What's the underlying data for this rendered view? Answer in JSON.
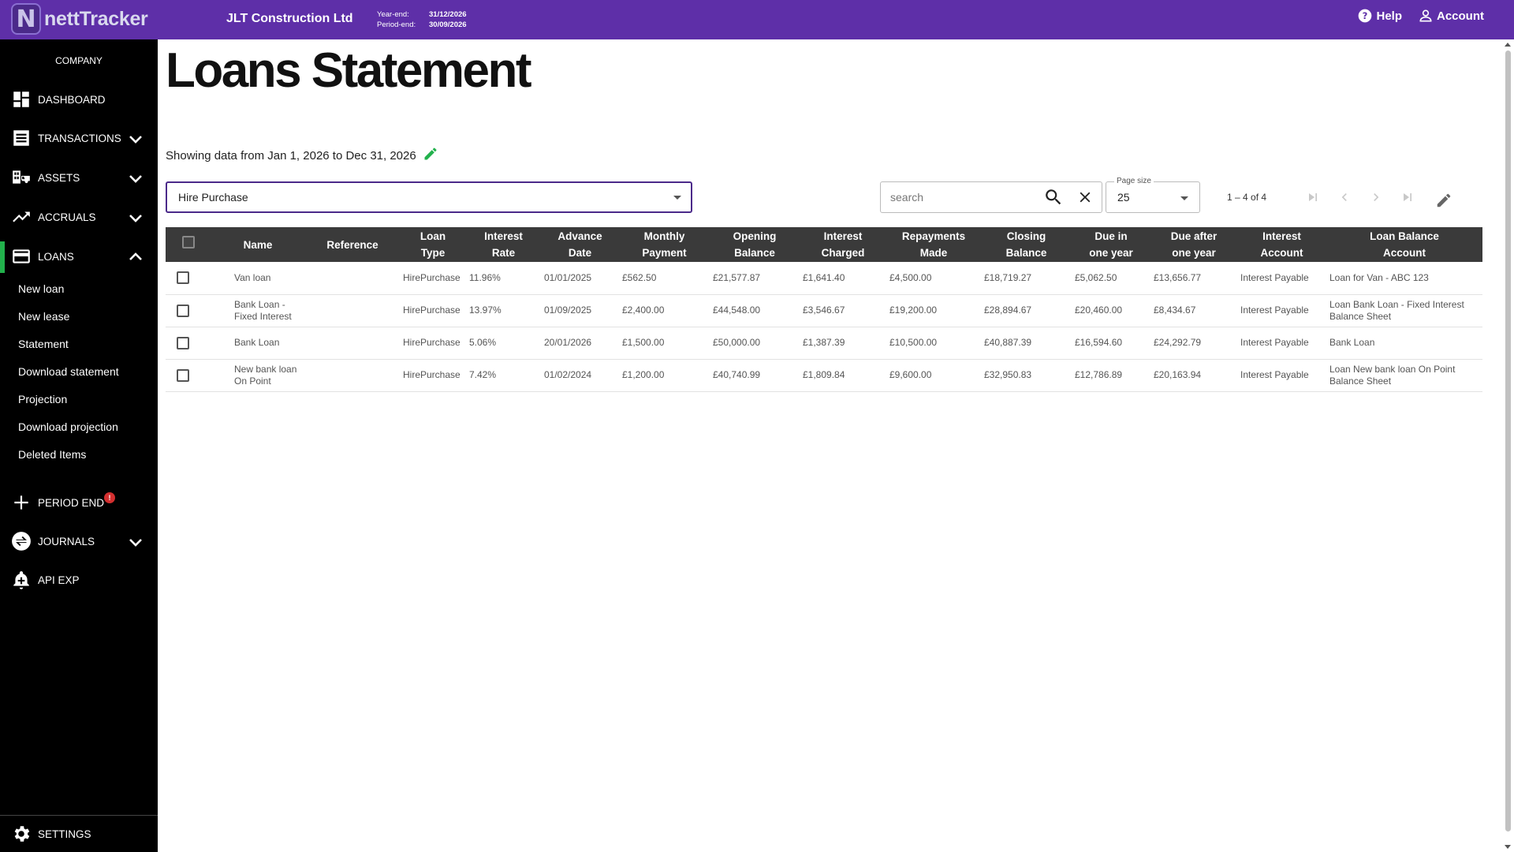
{
  "brand": {
    "logo_letter": "N",
    "name": "nettTracker"
  },
  "header": {
    "company": "JLT Construction Ltd",
    "year_end_label": "Year-end:",
    "year_end_value": "31/12/2026",
    "period_end_label": "Period-end:",
    "period_end_value": "30/09/2026",
    "help_label": "Help",
    "account_label": "Account"
  },
  "sidebar": {
    "company_label": "COMPANY",
    "items": [
      {
        "label": "DASHBOARD",
        "icon": "dashboard-icon"
      },
      {
        "label": "TRANSACTIONS",
        "icon": "list-icon"
      },
      {
        "label": "ASSETS",
        "icon": "assets-icon"
      },
      {
        "label": "ACCRUALS",
        "icon": "trending-up-icon"
      },
      {
        "label": "LOANS",
        "icon": "card-icon"
      },
      {
        "label": "PERIOD END",
        "icon": "plus-icon"
      },
      {
        "label": "JOURNALS",
        "icon": "swap-icon"
      },
      {
        "label": "API EXP",
        "icon": "notification-add-icon"
      }
    ],
    "loans_sub": [
      "New loan",
      "New lease",
      "Statement",
      "Download statement",
      "Projection",
      "Download projection",
      "Deleted Items"
    ],
    "period_end_badge": "!",
    "settings_label": "SETTINGS"
  },
  "main": {
    "title": "Loans Statement",
    "date_range": "Showing data from Jan 1, 2026 to Dec 31, 2026",
    "loan_type_selected": "Hire Purchase",
    "search_placeholder": "search",
    "page_size_label": "Page size",
    "page_size_value": "25",
    "range_label": "1 – 4 of 4"
  },
  "table": {
    "columns": [
      "",
      "Name",
      "Reference",
      "Loan\nType",
      "Interest\nRate",
      "Advance\nDate",
      "Monthly\nPayment",
      "Opening\nBalance",
      "Interest\nCharged",
      "Repayments\nMade",
      "Closing\nBalance",
      "Due in\none year",
      "Due after\none year",
      "Interest\nAccount",
      "Loan Balance\nAccount"
    ],
    "rows": [
      [
        "Van loan",
        "",
        "HirePurchase",
        "11.96%",
        "01/01/2025",
        "£562.50",
        "£21,577.87",
        "£1,641.40",
        "£4,500.00",
        "£18,719.27",
        "£5,062.50",
        "£13,656.77",
        "Interest Payable",
        "Loan for Van - ABC 123"
      ],
      [
        "Bank Loan - Fixed Interest",
        "",
        "HirePurchase",
        "13.97%",
        "01/09/2025",
        "£2,400.00",
        "£44,548.00",
        "£3,546.67",
        "£19,200.00",
        "£28,894.67",
        "£20,460.00",
        "£8,434.67",
        "Interest Payable",
        "Loan Bank Loan - Fixed Interest Balance Sheet"
      ],
      [
        "Bank Loan",
        "",
        "HirePurchase",
        "5.06%",
        "20/01/2026",
        "£1,500.00",
        "£50,000.00",
        "£1,387.39",
        "£10,500.00",
        "£40,887.39",
        "£16,594.60",
        "£24,292.79",
        "Interest Payable",
        "Bank Loan"
      ],
      [
        "New bank loan On Point",
        "",
        "HirePurchase",
        "7.42%",
        "01/02/2024",
        "£1,200.00",
        "£40,740.99",
        "£1,809.84",
        "£9,600.00",
        "£32,950.83",
        "£12,786.89",
        "£20,163.94",
        "Interest Payable",
        "Loan New bank loan On Point Balance Sheet"
      ]
    ]
  },
  "colors": {
    "topbar": "#5e2fa8",
    "sidebar": "#000000",
    "active_indicator": "#22b14c",
    "edit_icon": "#22b14c",
    "table_header": "#3a3a3a"
  }
}
